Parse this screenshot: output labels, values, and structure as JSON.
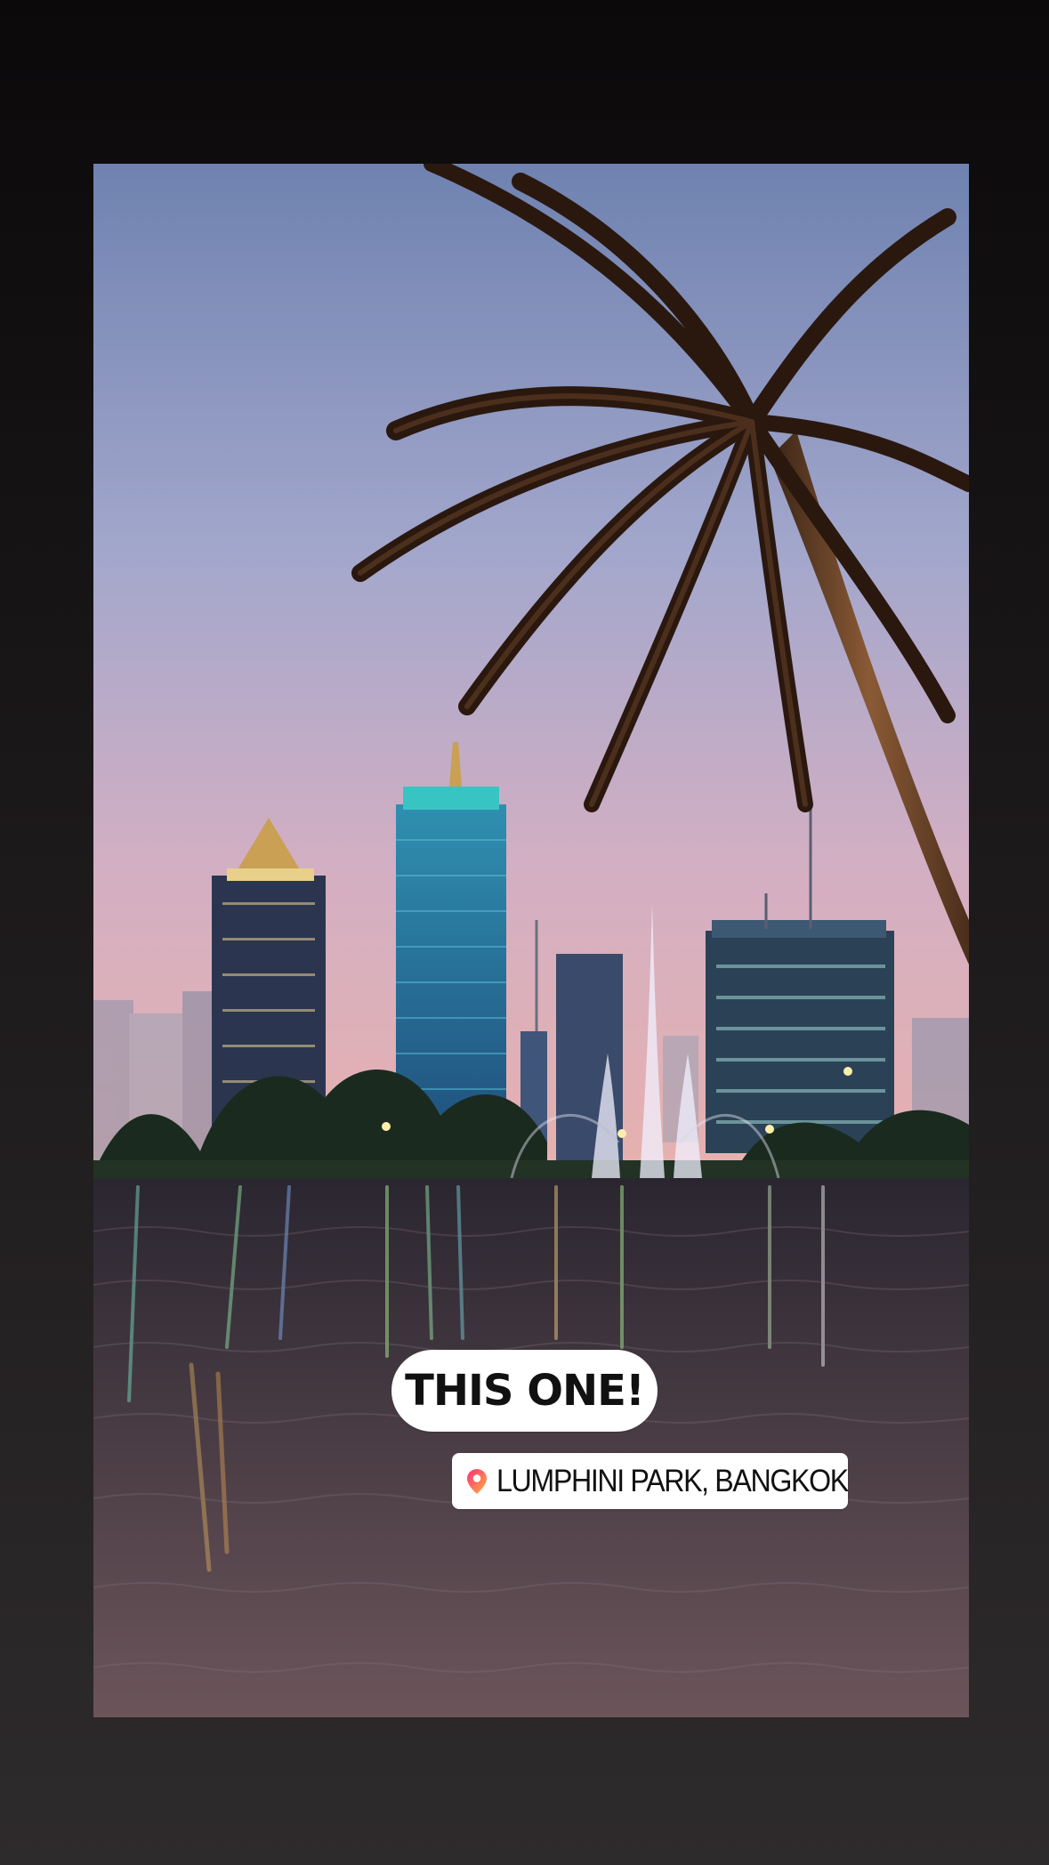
{
  "story": {
    "text_sticker": "THIS ONE!",
    "location_sticker": {
      "label": "LUMPHINI PARK, BANGKOK",
      "icon": "location-pin-icon"
    }
  },
  "colors": {
    "background_top": "#0b090a",
    "background_bottom": "#2e2b2c",
    "sky_top": "#6f82b0",
    "sky_bottom": "#e2a8ae",
    "water": "#3a3136",
    "sticker_background": "#ffffff",
    "sticker_text": "#111111",
    "pin_gradient_start": "#ff2f75",
    "pin_gradient_end": "#ffb23f"
  }
}
